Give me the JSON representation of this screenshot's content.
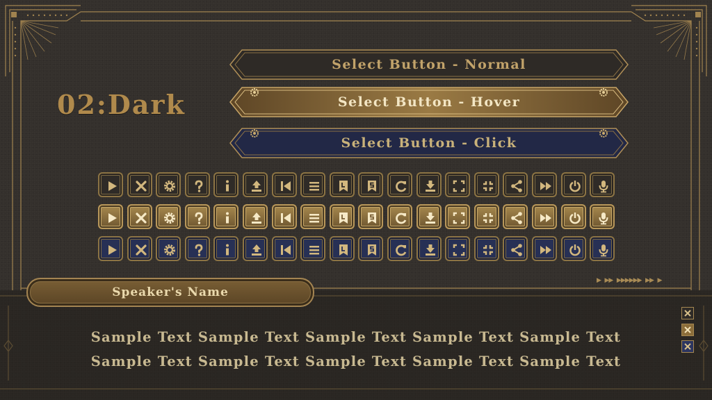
{
  "title": "02:Dark",
  "select_buttons": {
    "normal": "Select Button - Normal",
    "hover": "Select Button - Hover",
    "click": "Select Button - Click"
  },
  "icon_rows": [
    "normal",
    "hover",
    "click"
  ],
  "icons": [
    "play-icon",
    "close-icon",
    "gear-icon",
    "help-icon",
    "info-icon",
    "upload-icon",
    "skip-back-icon",
    "menu-icon",
    "bookmark-l-icon",
    "bookmark-s-icon",
    "reload-icon",
    "download-icon",
    "fullscreen-icon",
    "exit-fullscreen-icon",
    "share-icon",
    "fast-forward-icon",
    "power-icon",
    "microphone-icon"
  ],
  "speaker_name": "Speaker's Name",
  "message_lines": [
    "Sample Text Sample Text Sample Text Sample Text Sample Text",
    "Sample Text Sample Text Sample Text Sample Text Sample Text"
  ],
  "colors": {
    "background": "#34302c",
    "gold": "#a48552",
    "hover_gold": "#8b6d3a",
    "click_navy": "#273055",
    "title": "#b08a4c"
  }
}
